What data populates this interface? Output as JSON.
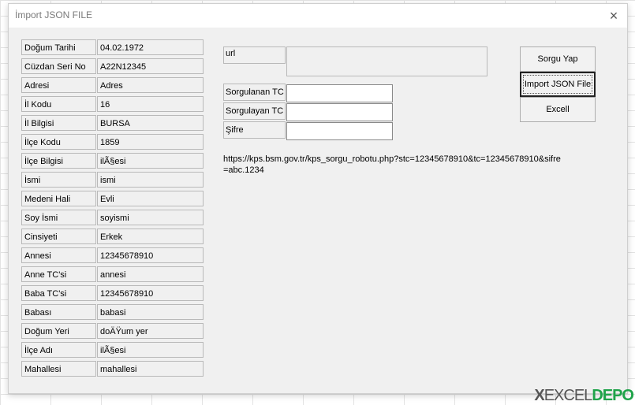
{
  "window": {
    "title": "İmport JSON FILE",
    "close_label": "×"
  },
  "fields": [
    {
      "label": "Doğum Tarihi",
      "value": "04.02.1972"
    },
    {
      "label": "Cüzdan Seri No",
      "value": "A22N12345"
    },
    {
      "label": "Adresi",
      "value": "Adres"
    },
    {
      "label": "İl Kodu",
      "value": "16"
    },
    {
      "label": "İl Bilgisi",
      "value": "BURSA"
    },
    {
      "label": "İlçe Kodu",
      "value": "1859"
    },
    {
      "label": "İlçe Bilgisi",
      "value": "ilÃ§esi"
    },
    {
      "label": "İsmi",
      "value": "ismi"
    },
    {
      "label": "Medeni Hali",
      "value": "Evli"
    },
    {
      "label": "Soy İsmi",
      "value": "soyismi"
    },
    {
      "label": "Cinsiyeti",
      "value": "Erkek"
    },
    {
      "label": "Annesi",
      "value": "12345678910"
    },
    {
      "label": "Anne TC'si",
      "value": "annesi"
    },
    {
      "label": "Baba TC'si",
      "value": "12345678910"
    },
    {
      "label": "Babası",
      "value": "babasi"
    },
    {
      "label": "Doğum Yeri",
      "value": "doÄŸum yer"
    },
    {
      "label": "İlçe Adı",
      "value": "ilÃ§esi"
    },
    {
      "label": "Mahallesi",
      "value": "mahallesi"
    }
  ],
  "query": {
    "url_label": "url",
    "url_value": "",
    "sorgulanan_label": "Sorgulanan TC",
    "sorgulanan_value": "",
    "sorgulayan_label": "Sorgulayan TC",
    "sorgulayan_value": "",
    "sifre_label": "Şifre",
    "sifre_value": ""
  },
  "buttons": {
    "query": "Sorgu Yap",
    "import": "Import JSON File",
    "excel": "Excell"
  },
  "result_url": "https://kps.bsm.gov.tr/kps_sorgu_robotu.php?stc=12345678910&tc=12345678910&sifre=abc.1234",
  "watermark": {
    "x": "X",
    "excel": "EXCEL",
    "depo": "DEPO"
  }
}
